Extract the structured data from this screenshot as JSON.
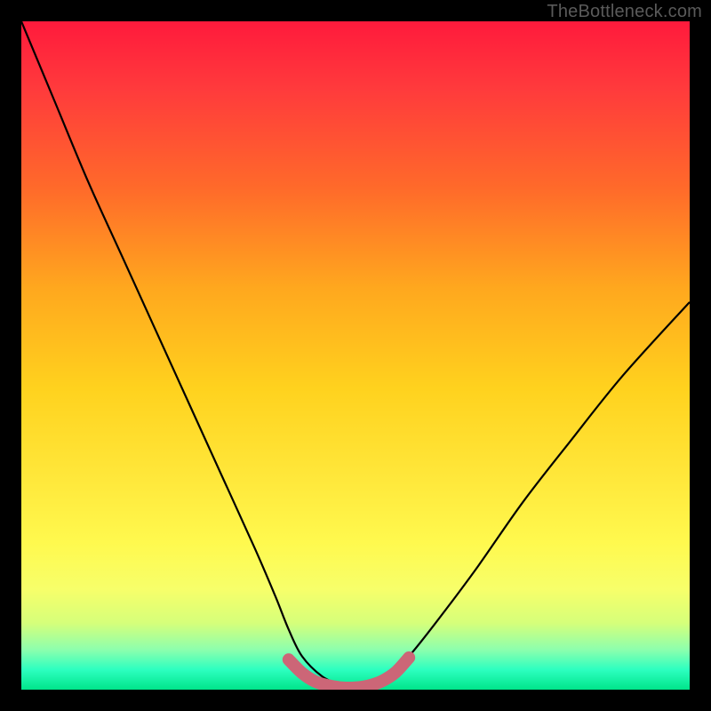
{
  "watermark": "TheBottleneck.com",
  "colors": {
    "frame": "#000000",
    "curve": "#000000",
    "highlight": "#cc6677",
    "gradient_top": "#ff1a3c",
    "gradient_bottom": "#00e58a"
  },
  "chart_data": {
    "type": "line",
    "title": "",
    "xlabel": "",
    "ylabel": "",
    "xlim": [
      0,
      100
    ],
    "ylim": [
      0,
      100
    ],
    "series": [
      {
        "name": "bottleneck-curve",
        "x": [
          0,
          5,
          10,
          15,
          20,
          25,
          30,
          35,
          38,
          40,
          42,
          45,
          48,
          50,
          52,
          55,
          58,
          62,
          68,
          75,
          82,
          90,
          100
        ],
        "y": [
          100,
          88,
          76,
          65,
          54,
          43,
          32,
          21,
          14,
          9,
          5,
          2,
          0.6,
          0.3,
          0.6,
          2,
          5,
          10,
          18,
          28,
          37,
          47,
          58
        ]
      },
      {
        "name": "highlight-floor",
        "x": [
          40,
          42,
          44,
          46,
          48,
          50,
          52,
          54,
          56,
          58
        ],
        "y": [
          4.5,
          2.5,
          1.2,
          0.6,
          0.3,
          0.3,
          0.6,
          1.3,
          2.6,
          4.8
        ]
      }
    ],
    "annotations": []
  }
}
